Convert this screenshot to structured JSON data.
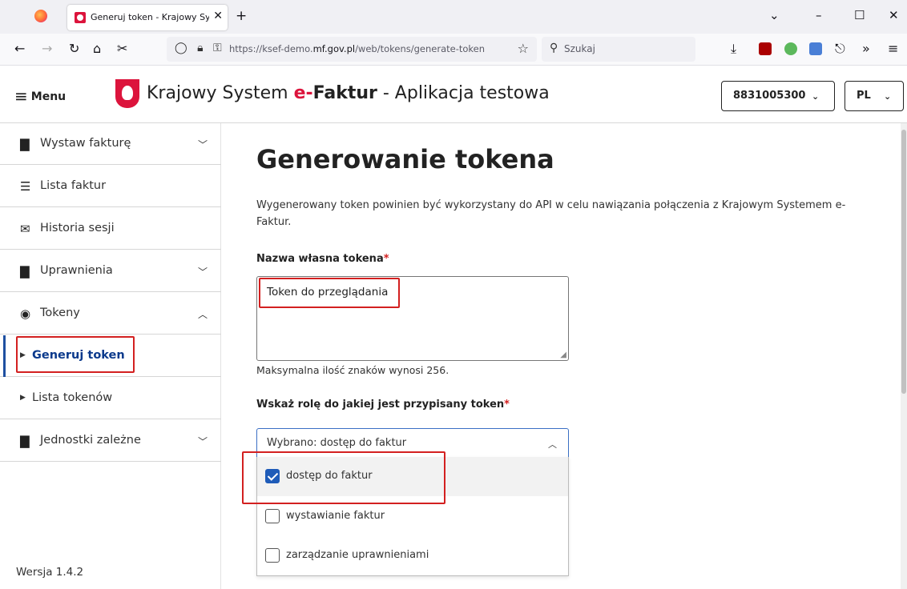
{
  "browser": {
    "tab_title": "Generuj token - Krajowy System e-Faktur",
    "url_prefix": "https://ksef-demo.",
    "url_domain": "mf.gov.pl",
    "url_path": "/web/tokens/generate-token",
    "search_placeholder": "Szukaj"
  },
  "header": {
    "menu_label": "Menu",
    "title_prefix": "Krajowy System ",
    "title_e": "e-",
    "title_faktur": "Faktur",
    "title_suffix": " - Aplikacja testowa",
    "nip": "8831005300",
    "lang": "PL"
  },
  "sidebar": {
    "items": [
      {
        "label": "Wystaw fakturę"
      },
      {
        "label": "Lista faktur"
      },
      {
        "label": "Historia sesji"
      },
      {
        "label": "Uprawnienia"
      },
      {
        "label": "Tokeny"
      },
      {
        "label": "Generuj token"
      },
      {
        "label": "Lista tokenów"
      },
      {
        "label": "Jednostki zależne"
      }
    ],
    "version": "Wersja 1.4.2"
  },
  "main": {
    "title": "Generowanie tokena",
    "intro": "Wygenerowany token powinien być wykorzystany do API w celu nawiązania połączenia z Krajowym Systemem e-Faktur.",
    "name_label": "Nazwa własna tokena",
    "name_value": "Token do przeglądania",
    "name_hint": "Maksymalna ilość znaków wynosi 256.",
    "role_label": "Wskaż rolę do jakiej jest przypisany token",
    "required_mark": "*",
    "role_selected": "Wybrano: dostęp do faktur",
    "role_options": [
      {
        "label": "dostęp do faktur",
        "checked": true
      },
      {
        "label": "wystawianie faktur",
        "checked": false
      },
      {
        "label": "zarządzanie uprawnieniami",
        "checked": false
      }
    ]
  },
  "colors": {
    "accent_red": "#dc143c",
    "link_blue": "#0b3a8c",
    "checkbox_blue": "#1e5bb8",
    "highlight_red": "#d32020"
  }
}
